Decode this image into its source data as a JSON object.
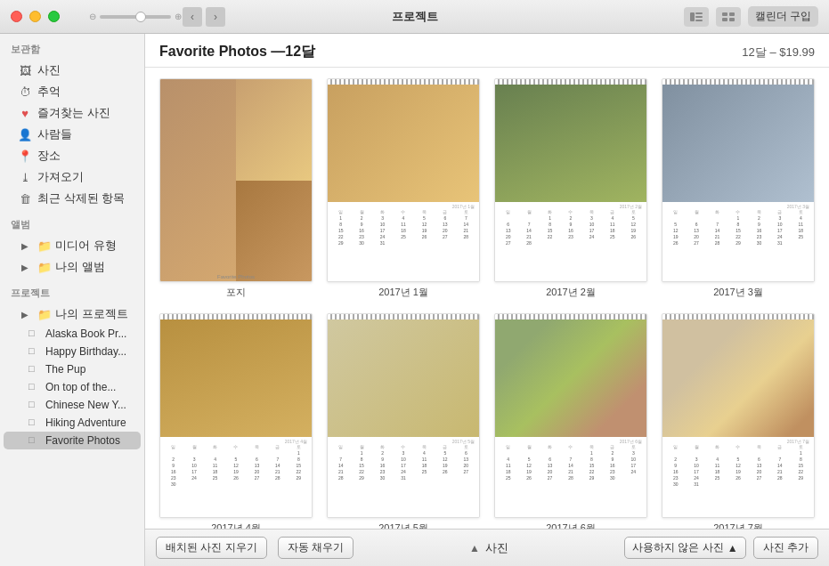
{
  "app": {
    "title": "프로젝트",
    "buy_button": "캘린더 구입"
  },
  "content": {
    "title": "Favorite Photos —12달",
    "price_label": "12달 – $19.99"
  },
  "sidebar": {
    "browse_label": "보관함",
    "items": [
      {
        "id": "photos",
        "icon": "🖼",
        "label": "사진"
      },
      {
        "id": "memories",
        "icon": "⏱",
        "label": "추억"
      },
      {
        "id": "favorites",
        "icon": "♥",
        "label": "즐겨찾는 사진"
      },
      {
        "id": "people",
        "icon": "👤",
        "label": "사람들"
      },
      {
        "id": "places",
        "icon": "📍",
        "label": "장소"
      },
      {
        "id": "imports",
        "icon": "⤓",
        "label": "가져오기"
      },
      {
        "id": "recently-deleted",
        "icon": "🗑",
        "label": "최근 삭제된 항목"
      }
    ],
    "albums_label": "앨범",
    "album_items": [
      {
        "id": "media-types",
        "icon": "▶",
        "label": "미디어 유형"
      },
      {
        "id": "my-albums",
        "icon": "▶",
        "label": "나의 앨범"
      }
    ],
    "projects_label": "프로젝트",
    "project_items": [
      {
        "id": "my-projects",
        "icon": "▶",
        "label": "나의 프로젝트"
      },
      {
        "id": "alaska",
        "icon": "□",
        "label": "Alaska Book Pr..."
      },
      {
        "id": "happy-birthday",
        "icon": "□",
        "label": "Happy Birthday..."
      },
      {
        "id": "the-pup",
        "icon": "□",
        "label": "The Pup"
      },
      {
        "id": "on-top",
        "icon": "□",
        "label": "On top of the..."
      },
      {
        "id": "chinese-new",
        "icon": "□",
        "label": "Chinese New Y..."
      },
      {
        "id": "hiking",
        "icon": "□",
        "label": "Hiking Adventure"
      },
      {
        "id": "favorite-photos",
        "icon": "□",
        "label": "Favorite Photos"
      }
    ]
  },
  "calendar_pages": [
    {
      "id": "cover",
      "label": "포지",
      "photo_class": "cover",
      "is_cover": true
    },
    {
      "id": "jan",
      "label": "2017년 1월",
      "photo_class": "photo-dog1",
      "month_label": "2017년 1월"
    },
    {
      "id": "feb",
      "label": "2017년 2월",
      "photo_class": "photo-dog2",
      "month_label": "2017년 2월"
    },
    {
      "id": "mar",
      "label": "2017년 3월",
      "photo_class": "photo-dog3",
      "month_label": "2017년 3월"
    },
    {
      "id": "apr",
      "label": "2017년 4월",
      "photo_class": "photo-dog4",
      "month_label": "2017년 4월"
    },
    {
      "id": "may",
      "label": "2017년 5월",
      "photo_class": "photo-dog5",
      "month_label": "2017년 5월"
    },
    {
      "id": "jun",
      "label": "2017년 6월",
      "photo_class": "photo-multi",
      "month_label": "2017년 6월"
    },
    {
      "id": "jul",
      "label": "2017년 7월",
      "photo_class": "photo-party",
      "month_label": "2017년 7월"
    }
  ],
  "toolbar": {
    "remove_placed_label": "배치된 사진 지우기",
    "auto_fill_label": "자동 채우기",
    "photos_label": "사진",
    "unused_photos_label": "사용하지 않은 사진",
    "add_photos_label": "사진 추가"
  }
}
